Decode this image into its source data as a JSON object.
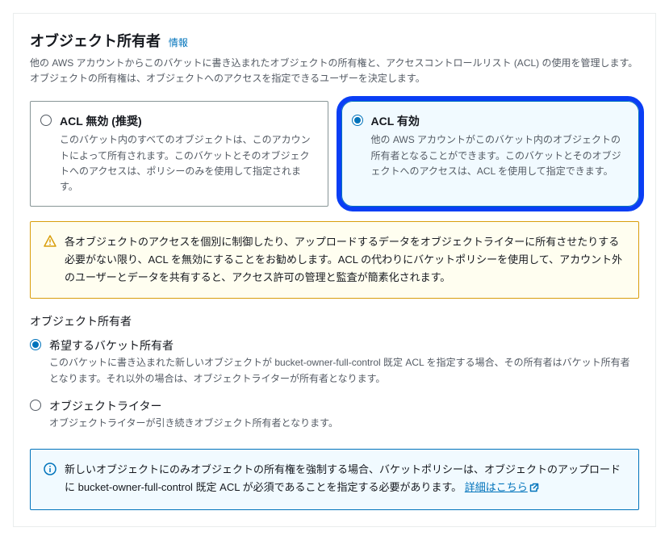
{
  "header": {
    "title": "オブジェクト所有者",
    "info_label": "情報",
    "description": "他の AWS アカウントからこのバケットに書き込まれたオブジェクトの所有権と、アクセスコントロールリスト (ACL) の使用を管理します。オブジェクトの所有権は、オブジェクトへのアクセスを指定できるユーザーを決定します。"
  },
  "acl_options": {
    "disabled": {
      "title": "ACL 無効 (推奨)",
      "description": "このバケット内のすべてのオブジェクトは、このアカウントによって所有されます。このバケットとそのオブジェクトへのアクセスは、ポリシーのみを使用して指定されます。"
    },
    "enabled": {
      "title": "ACL 有効",
      "description": "他の AWS アカウントがこのバケット内のオブジェクトの所有者となることができます。このバケットとそのオブジェクトへのアクセスは、ACL を使用して指定できます。"
    }
  },
  "warning_text": "各オブジェクトのアクセスを個別に制御したり、アップロードするデータをオブジェクトライターに所有させたりする必要がない限り、ACL を無効にすることをお勧めします。ACL の代わりにバケットポリシーを使用して、アカウント外のユーザーとデータを共有すると、アクセス許可の管理と監査が簡素化されます。",
  "owner_section": {
    "label": "オブジェクト所有者",
    "preferred": {
      "title": "希望するバケット所有者",
      "description": "このバケットに書き込まれた新しいオブジェクトが bucket-owner-full-control 既定 ACL を指定する場合、その所有者はバケット所有者となります。それ以外の場合は、オブジェクトライターが所有者となります。"
    },
    "writer": {
      "title": "オブジェクトライター",
      "description": "オブジェクトライターが引き続きオブジェクト所有者となります。"
    }
  },
  "info_alert": {
    "text": "新しいオブジェクトにのみオブジェクトの所有権を強制する場合、バケットポリシーは、オブジェクトのアップロードに bucket-owner-full-control 既定 ACL が必須であることを指定する必要があります。",
    "link_text": "詳細はこちら"
  }
}
